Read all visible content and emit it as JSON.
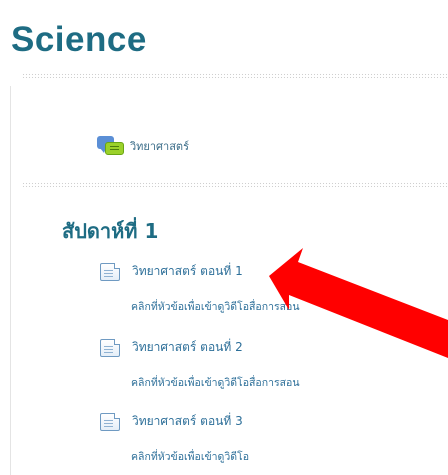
{
  "course": {
    "title": "Science"
  },
  "forum": {
    "label": "วิทยาศาสตร์",
    "icon": "forum-icon"
  },
  "week": {
    "title": "สัปดาห์ที่ 1"
  },
  "pages": [
    {
      "title": "วิทยาศาสตร์ ตอนที่ 1",
      "description": "คลิกที่หัวข้อเพื่อเข้าดูวิดีโอสื่อการสอน",
      "icon": "page-icon"
    },
    {
      "title": "วิทยาศาสตร์ ตอนที่ 2",
      "description": "คลิกที่หัวข้อเพื่อเข้าดูวิดีโอสื่อการสอน",
      "icon": "page-icon"
    },
    {
      "title": "วิทยาศาสตร์ ตอนที่ 3",
      "description": "คลิกที่หัวข้อเพื่อเข้าดูวิดีโอ",
      "icon": "page-icon"
    }
  ],
  "colors": {
    "accent": "#1e6c83",
    "link": "#2d6f99",
    "arrow": "#ff0000"
  }
}
